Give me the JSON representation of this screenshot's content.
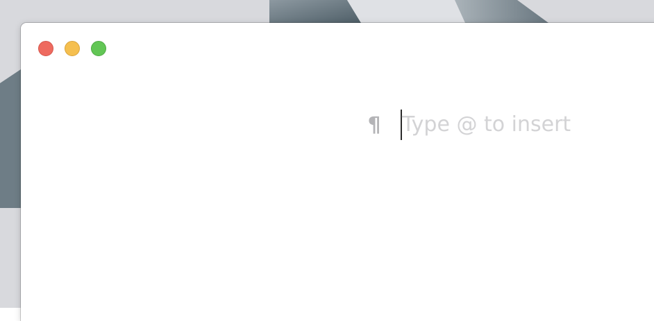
{
  "window": {
    "controls": {
      "close": "close",
      "minimize": "minimize",
      "zoom": "zoom"
    }
  },
  "editor": {
    "block_icon": "paragraph-icon",
    "block_glyph": "¶",
    "placeholder": "Type @ to insert"
  },
  "colors": {
    "close": "#ee6a5f",
    "minimize": "#f5bf4f",
    "zoom": "#62c655",
    "placeholder_text": "#d3d3d5",
    "block_icon": "#b4b4b7"
  }
}
